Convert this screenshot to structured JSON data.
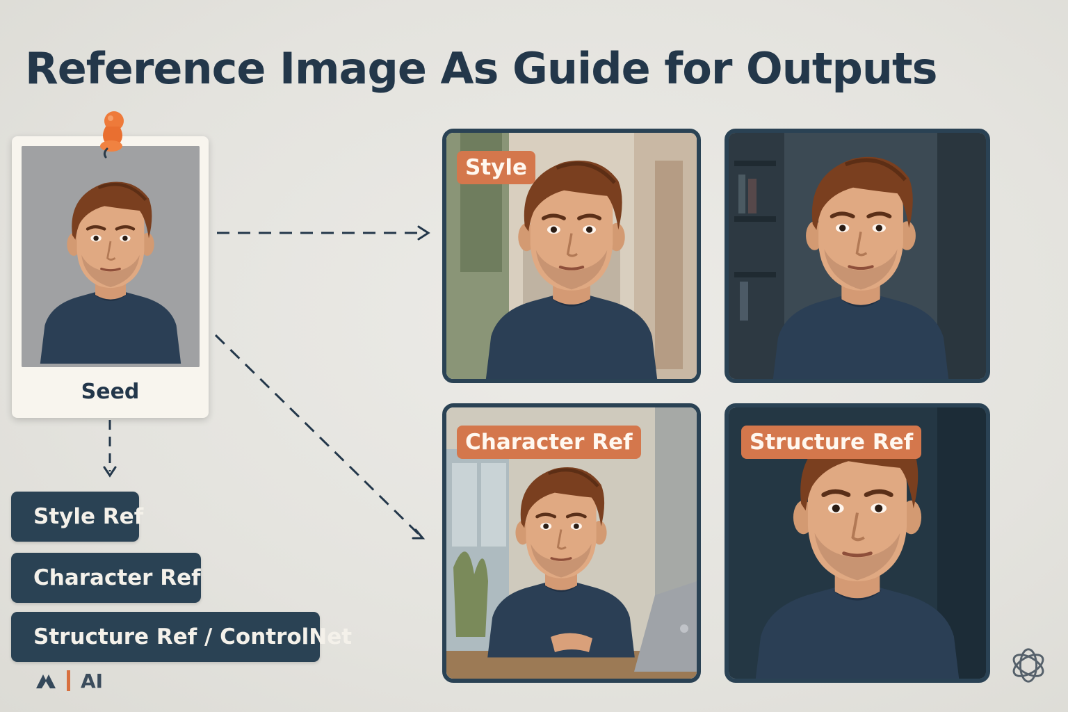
{
  "title": "Reference Image As Guide for Outputs",
  "seed": {
    "label": "Seed"
  },
  "panels": {
    "style_badge": "Style",
    "character_badge": "Character Ref",
    "structure_badge": "Structure Ref"
  },
  "ref_buttons": [
    "Style Ref",
    "Character Ref",
    "Structure Ref / ControlNet"
  ],
  "footer": {
    "logo_text": "AI"
  },
  "colors": {
    "title": "#23374a",
    "panel_border": "#2a4254",
    "badge": "#d4774c",
    "button": "#2a4254",
    "pin": "#ee7a3a",
    "background": "#e6e5e0"
  },
  "icons": [
    "pushpin-icon",
    "dashed-arrow-icon",
    "openai-logo-icon",
    "brand-logo-icon"
  ]
}
